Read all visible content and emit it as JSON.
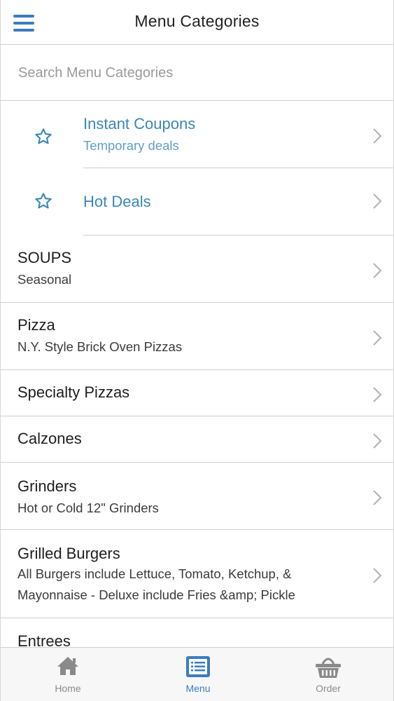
{
  "header": {
    "title": "Menu Categories"
  },
  "search": {
    "placeholder": "Search Menu Categories",
    "value": ""
  },
  "featured": [
    {
      "title": "Instant Coupons",
      "subtitle": "Temporary deals"
    },
    {
      "title": "Hot Deals",
      "subtitle": ""
    }
  ],
  "categories": [
    {
      "title": "SOUPS",
      "subtitle": "Seasonal"
    },
    {
      "title": "Pizza",
      "subtitle": "N.Y. Style Brick Oven Pizzas"
    },
    {
      "title": "Specialty Pizzas",
      "subtitle": ""
    },
    {
      "title": "Calzones",
      "subtitle": ""
    },
    {
      "title": "Grinders",
      "subtitle": "Hot or Cold 12\" Grinders"
    },
    {
      "title": "Grilled Burgers",
      "subtitle": "All Burgers include Lettuce, Tomato, Ketchup, & Mayonnaise - Deluxe include Fries &amp; Pickle"
    },
    {
      "title": "Entrees",
      "subtitle": ""
    }
  ],
  "tabs": [
    {
      "label": "Home",
      "icon": "home-icon"
    },
    {
      "label": "Menu",
      "icon": "menu-list-icon"
    },
    {
      "label": "Order",
      "icon": "basket-icon"
    }
  ],
  "colors": {
    "accent": "#3a7cbf",
    "featured_text": "#3a86b9",
    "tab_inactive": "#8a8a8a"
  }
}
